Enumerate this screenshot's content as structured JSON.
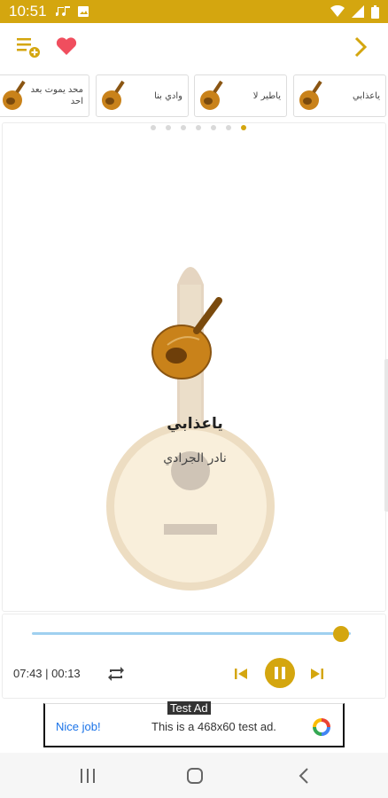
{
  "status_bar": {
    "time": "10:51"
  },
  "playlist": [
    {
      "label": "ياعذابي"
    },
    {
      "label": "ياطير لا"
    },
    {
      "label": "وادي بنا"
    },
    {
      "label": "محد يموت بعد احد"
    }
  ],
  "pager": {
    "count": 7,
    "active_index": 6
  },
  "now_playing": {
    "title": "ياعذابي",
    "artist": "نادر الجرادي"
  },
  "player": {
    "time_readout": "07:43 | 00:13",
    "progress_fraction": 0.97
  },
  "ad": {
    "tag": "Test Ad",
    "headline": "Nice job!",
    "message": "This is a 468x60 test ad."
  },
  "colors": {
    "accent": "#d4a60f",
    "heart": "#f04e5e",
    "seek_track": "#9fd0f0"
  },
  "icons": [
    "queue-add-icon",
    "heart-icon",
    "chevron-right-icon",
    "oud-icon",
    "repeat-icon",
    "skip-previous-icon",
    "pause-icon",
    "skip-next-icon",
    "recents-icon",
    "home-icon",
    "back-icon"
  ]
}
